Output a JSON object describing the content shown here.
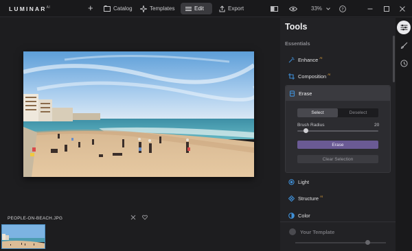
{
  "app": {
    "logo": "LUMINAR",
    "logo_suffix": "AI"
  },
  "topbar": {
    "add_icon": "plus-icon",
    "catalog": "Catalog",
    "templates": "Templates",
    "edit": "Edit",
    "export": "Export",
    "zoom": "33%"
  },
  "photo": {
    "filename": "PEOPLE-ON-BEACH.JPG"
  },
  "panel": {
    "title": "Tools",
    "section": "Essentials",
    "tools": [
      {
        "label": "Enhance",
        "ai": "AI",
        "icon": "enhance-icon"
      },
      {
        "label": "Composition",
        "ai": "AI",
        "icon": "composition-icon"
      },
      {
        "label": "Erase",
        "icon": "erase-icon"
      },
      {
        "label": "Light",
        "icon": "light-icon"
      },
      {
        "label": "Structure",
        "ai": "AI",
        "icon": "structure-icon"
      },
      {
        "label": "Color",
        "icon": "color-icon"
      }
    ],
    "erase": {
      "mode_select": "Select",
      "mode_deselect": "Deselect",
      "brush_label": "Brush Radius",
      "brush_value": "20",
      "brush_level": 0.1,
      "erase_button": "Erase",
      "clear_button": "Clear Selection"
    },
    "template": {
      "label": "Your Template",
      "level": 0.8
    }
  },
  "colors": {
    "accent": "#6a5a94",
    "tool_icon": "#3f8fd6",
    "ai_badge": "#e0a23a",
    "thumb_border": "#4a8ec2"
  }
}
